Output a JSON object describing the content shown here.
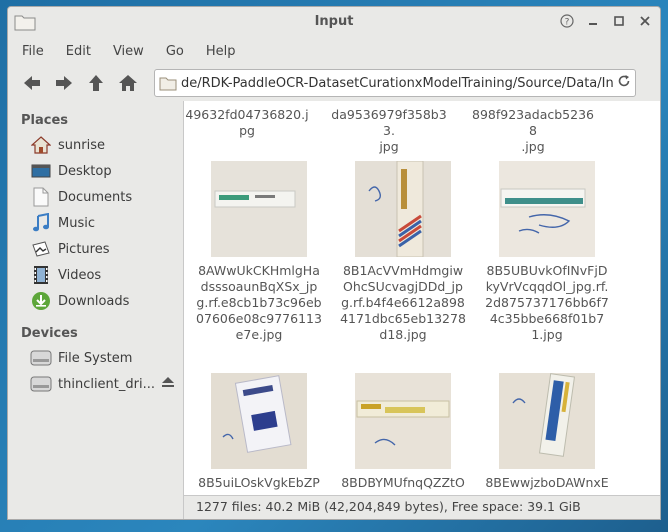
{
  "window": {
    "title": "Input"
  },
  "menu": [
    "File",
    "Edit",
    "View",
    "Go",
    "Help"
  ],
  "location": {
    "path": "de/RDK-PaddleOCR-DatasetCurationxModelTraining/Source/Data/Input/"
  },
  "sidebar": {
    "places_heading": "Places",
    "places": [
      {
        "label": "sunrise",
        "icon": "home-icon"
      },
      {
        "label": "Desktop",
        "icon": "desktop-icon"
      },
      {
        "label": "Documents",
        "icon": "documents-icon"
      },
      {
        "label": "Music",
        "icon": "music-icon"
      },
      {
        "label": "Pictures",
        "icon": "pictures-icon"
      },
      {
        "label": "Videos",
        "icon": "videos-icon"
      },
      {
        "label": "Downloads",
        "icon": "downloads-icon"
      }
    ],
    "devices_heading": "Devices",
    "devices": [
      {
        "label": "File System",
        "icon": "drive-icon"
      },
      {
        "label": "thinclient_dri...",
        "icon": "drive-icon"
      }
    ]
  },
  "files_top_partial": [
    "49632fd04736820.j\npg",
    "da9536979f358b33.\njpg",
    "898f923adacb52368\n.jpg"
  ],
  "files": [
    {
      "name": "8AWwUkCKHmlgHadsssoaunBqXSx_jpg.rf.e8cb1b73c96eb07606e08c9776113e7e.jpg"
    },
    {
      "name": "8B1AcVVmHdmgiwOhcSUcvagjDDd_jpg.rf.b4f4e6612a8984171dbc65eb13278d18.jpg"
    },
    {
      "name": "8B5UBUvkOfINvFjDkyVrVcqqdOl_jpg.rf.2d875737176bb6f74c35bbe668f01b71.jpg"
    },
    {
      "name": "8B5uiLOskVgkEbZP"
    },
    {
      "name": "8BDBYMUfnqQZZtO"
    },
    {
      "name": "8BEwwjzboDAWnxE"
    }
  ],
  "status": {
    "text": "1277 files: 40.2 MiB (42,204,849 bytes), Free space: 39.1 GiB"
  },
  "colors": {
    "window_bg": "#e9e9e7",
    "content_bg": "#ffffff",
    "desktop_bg": "#2a7db0"
  }
}
